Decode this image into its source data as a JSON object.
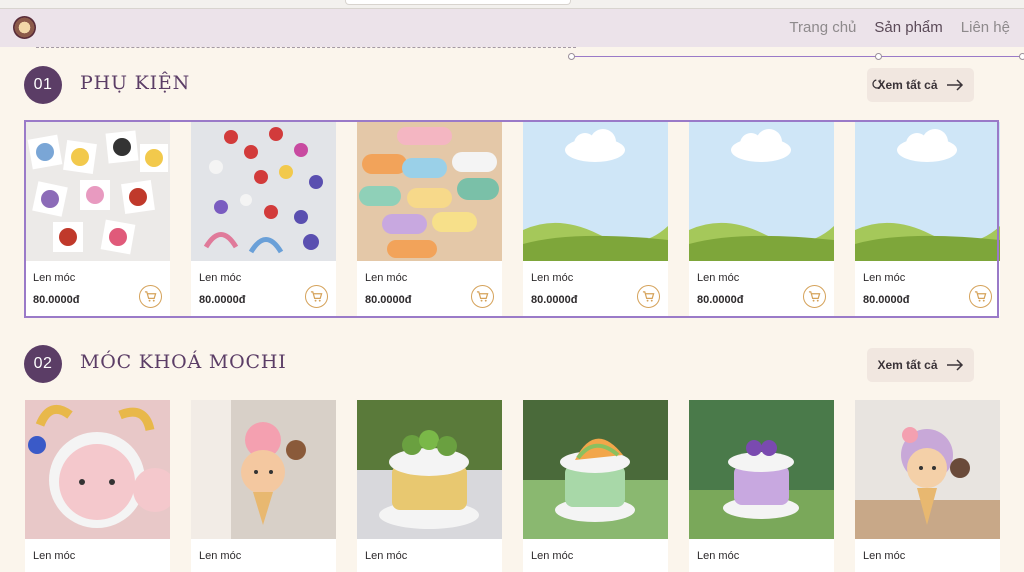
{
  "nav": {
    "links": [
      {
        "label": "Trang chủ",
        "active": false
      },
      {
        "label": "Sản phẩm",
        "active": true
      },
      {
        "label": "Liên hệ",
        "active": false
      }
    ]
  },
  "sections": [
    {
      "number": "01",
      "title": "PHỤ KIỆN",
      "view_all": "Xem tất cả",
      "products": [
        {
          "name": "Len móc",
          "price": "80.0000đ",
          "image": "crochet-cat-coasters"
        },
        {
          "name": "Len móc",
          "price": "80.0000đ",
          "image": "crochet-hair-clips"
        },
        {
          "name": "Len móc",
          "price": "80.0000đ",
          "image": "crochet-bubble-clips"
        },
        {
          "name": "Len móc",
          "price": "80.0000đ",
          "image": "placeholder-landscape"
        },
        {
          "name": "Len móc",
          "price": "80.0000đ",
          "image": "placeholder-landscape"
        },
        {
          "name": "Len móc",
          "price": "80.0000đ",
          "image": "placeholder-landscape"
        }
      ]
    },
    {
      "number": "02",
      "title": "MÓC KHOÁ MOCHI",
      "view_all": "Xem tất cả",
      "products": [
        {
          "name": "Len móc",
          "image": "crochet-doll-keychain"
        },
        {
          "name": "Len móc",
          "image": "crochet-icecream-keychain"
        },
        {
          "name": "Len móc",
          "image": "crochet-green-cake"
        },
        {
          "name": "Len móc",
          "image": "crochet-orange-cake"
        },
        {
          "name": "Len móc",
          "image": "crochet-purple-cake"
        },
        {
          "name": "Len móc",
          "image": "crochet-bear-icecream"
        }
      ]
    }
  ],
  "colors": {
    "accent": "#5b3d66",
    "cart": "#d5a25a",
    "background": "#fbf5ec",
    "navbar": "#ece3ea",
    "selection": "#9a7ac8"
  }
}
